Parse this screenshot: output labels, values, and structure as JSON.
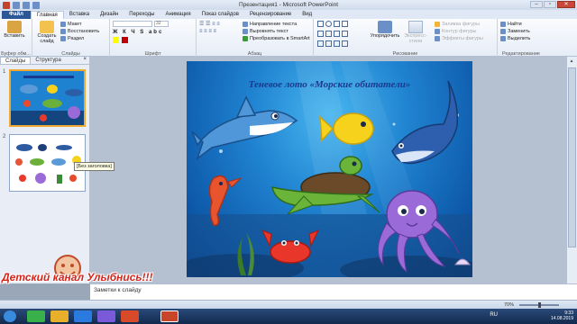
{
  "window": {
    "title": "Презентация1 - Microsoft PowerPoint"
  },
  "tabs": [
    {
      "label": "Файл"
    },
    {
      "label": "Главная"
    },
    {
      "label": "Вставка"
    },
    {
      "label": "Дизайн"
    },
    {
      "label": "Переходы"
    },
    {
      "label": "Анимация"
    },
    {
      "label": "Показ слайдов"
    },
    {
      "label": "Рецензирование"
    },
    {
      "label": "Вид"
    }
  ],
  "ribbon": {
    "clipboard": {
      "paste": "Вставить",
      "label": "Буфер обм..."
    },
    "slides": {
      "new_slide": "Создать слайд",
      "layout": "Макет",
      "reset": "Восстановить",
      "section": "Раздел",
      "label": "Слайды"
    },
    "font": {
      "font_name": "",
      "font_size": "32",
      "label": "Шрифт"
    },
    "paragraph": {
      "text_direction": "Направление текста",
      "align_text": "Выровнять текст",
      "smartart": "Преобразовать в SmartArt",
      "label": "Абзац"
    },
    "drawing": {
      "arrange": "Упорядочить",
      "quick_styles": "Экспресс-стили",
      "fill": "Заливка фигуры",
      "outline": "Контур фигуры",
      "effects": "Эффекты фигуры",
      "label": "Рисование"
    },
    "editing": {
      "find": "Найти",
      "replace": "Заменить",
      "select": "Выделить",
      "label": "Редактирование"
    }
  },
  "left_panel": {
    "tab_slides": "Слайды",
    "tab_outline": "Структура",
    "close": "×",
    "slide_numbers": [
      "1",
      "2"
    ],
    "tooltip": "[Без заголовка]"
  },
  "slide": {
    "title": "Теневое лото «Морские обитатели»"
  },
  "notes": {
    "placeholder": "Заметки к слайду"
  },
  "status": {
    "zoom": "70%",
    "lang": "RU"
  },
  "clock": {
    "time": "9:33",
    "date": "14.08.2019"
  },
  "watermark": {
    "text": "Детский канал Улыбнись!!!"
  },
  "colors": {
    "file_tab": "#2b5797",
    "slide_title": "#1a3a8f",
    "watermark_red": "#d4241b"
  }
}
